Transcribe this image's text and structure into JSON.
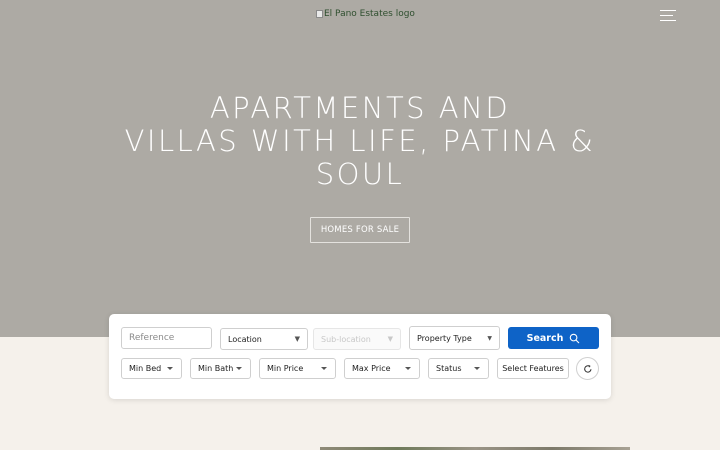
{
  "header": {
    "logo_alt": "El Pano Estates logo"
  },
  "hero": {
    "headline_line1": "APARTMENTS AND",
    "headline_line2": "VILLAS WITH LIFE, PATINA &",
    "headline_line3": "SOUL",
    "cta_label": "HOMES FOR SALE"
  },
  "search": {
    "reference_placeholder": "Reference",
    "location_label": "Location",
    "sublocation_placeholder": "Sub-location",
    "property_type_label": "Property Type",
    "search_label": "Search",
    "min_bed_label": "Min Bed",
    "min_bath_label": "Min Bath",
    "min_price_label": "Min Price",
    "max_price_label": "Max Price",
    "status_label": "Status",
    "features_label": "Select Features"
  },
  "colors": {
    "hero_bg": "#adaaa4",
    "page_bg": "#f5f1eb",
    "accent": "#0e63c7"
  },
  "icons": [
    "menu-icon",
    "search-icon",
    "reset-icon",
    "dropdown-arrow-icon"
  ]
}
